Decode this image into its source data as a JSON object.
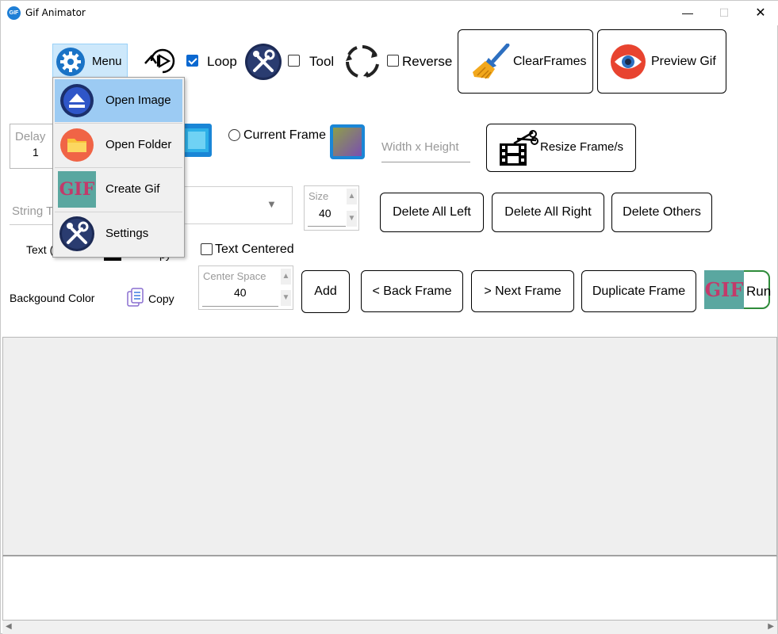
{
  "window": {
    "title": "Gif Animator",
    "app_icon_text": "GIF",
    "minimize": "—",
    "maximize": "☐",
    "close": "✕"
  },
  "toolbar": {
    "menu_label": "Menu",
    "loop_label": "Loop",
    "loop_checked": true,
    "tool_label": "Tool",
    "tool_checked": false,
    "reverse_label": "Reverse",
    "reverse_checked": false,
    "clear_frames_label": "ClearFrames",
    "preview_gif_label": "Preview Gif"
  },
  "menu": {
    "items": [
      {
        "label": "Open Image",
        "icon": "eject-icon",
        "active": true
      },
      {
        "label": "Open Folder",
        "icon": "folder-icon",
        "active": false
      },
      {
        "label": "Create Gif",
        "icon": "gif-icon",
        "active": false
      },
      {
        "label": "Settings",
        "icon": "tools-icon",
        "active": false
      }
    ],
    "gif_icon_text": "GIF"
  },
  "row2": {
    "delay_caption": "Delay",
    "delay_value": "1",
    "current_frame_label": "Current Frame",
    "size_placeholder": "Width x Height",
    "resize_label": "Resize Frame/s"
  },
  "row3": {
    "string_placeholder": "String T",
    "size_caption": "Size",
    "size_value": "40",
    "delete_all_left": "Delete All Left",
    "delete_all_right": "Delete All Right",
    "delete_others": "Delete Others"
  },
  "row4": {
    "text_color_label": "Text (",
    "text_copy_partial": "py",
    "text_centered_label": "Text Centered"
  },
  "row5": {
    "background_color_label": "Backgound Color",
    "copy_label": "Copy",
    "center_space_caption": "Center Space",
    "center_space_value": "40",
    "add_label": "Add",
    "back_frame_label": "< Back Frame",
    "next_frame_label": "> Next Frame",
    "duplicate_frame_label": "Duplicate Frame",
    "run_label": "Run",
    "run_icon_text": "GIF"
  },
  "scrollbar": {
    "left_arrow": "◀",
    "right_arrow": "▶"
  }
}
